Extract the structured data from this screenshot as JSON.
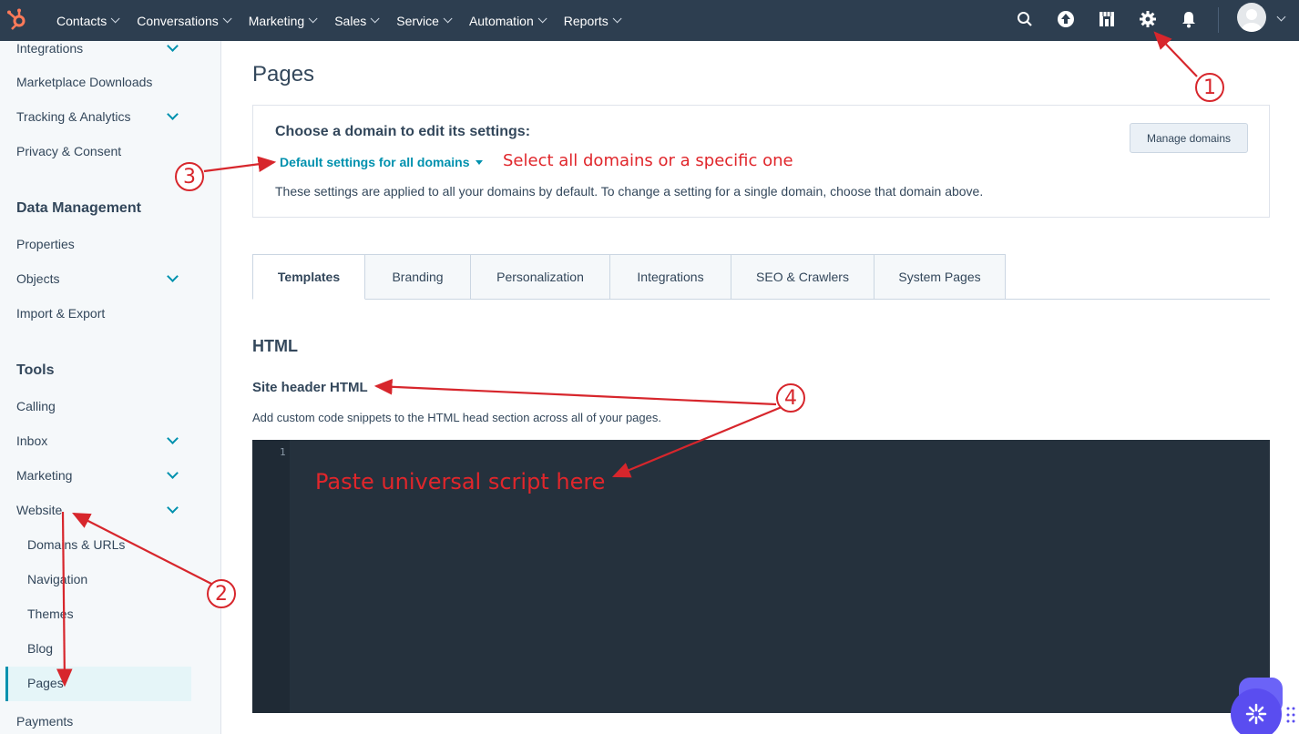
{
  "topnav": {
    "items": [
      "Contacts",
      "Conversations",
      "Marketing",
      "Sales",
      "Service",
      "Automation",
      "Reports"
    ],
    "icons": [
      "search-icon",
      "upgrade-icon",
      "marketplace-icon",
      "settings-icon",
      "notifications-icon"
    ]
  },
  "sidebar": {
    "items": {
      "integrations": "Integrations",
      "marketplace_downloads": "Marketplace Downloads",
      "tracking_analytics": "Tracking & Analytics",
      "privacy_consent": "Privacy & Consent",
      "data_management": "Data Management",
      "properties": "Properties",
      "objects": "Objects",
      "import_export": "Import & Export",
      "tools": "Tools",
      "calling": "Calling",
      "inbox": "Inbox",
      "marketing": "Marketing",
      "website": "Website",
      "domains_urls": "Domains & URLs",
      "navigation": "Navigation",
      "themes": "Themes",
      "blog": "Blog",
      "pages": "Pages",
      "payments": "Payments"
    }
  },
  "main": {
    "title": "Pages",
    "domain_card": {
      "heading": "Choose a domain to edit its settings:",
      "selected_domain": "Default settings for all domains",
      "description": "These settings are applied to all your domains by default. To change a setting for a single domain, choose that domain above.",
      "manage_button": "Manage domains"
    },
    "tabs": [
      "Templates",
      "Branding",
      "Personalization",
      "Integrations",
      "SEO & Crawlers",
      "System Pages"
    ],
    "section_title": "HTML",
    "subsection_title": "Site header HTML",
    "subsection_desc": "Add custom code snippets to the HTML head section across all of your pages.",
    "editor_line_number": "1"
  },
  "annotations": {
    "select_domain": "Select all domains or a specific one",
    "paste_script": "Paste universal script here",
    "markers": [
      "1",
      "2",
      "3",
      "4"
    ],
    "color": "#e0262b"
  }
}
